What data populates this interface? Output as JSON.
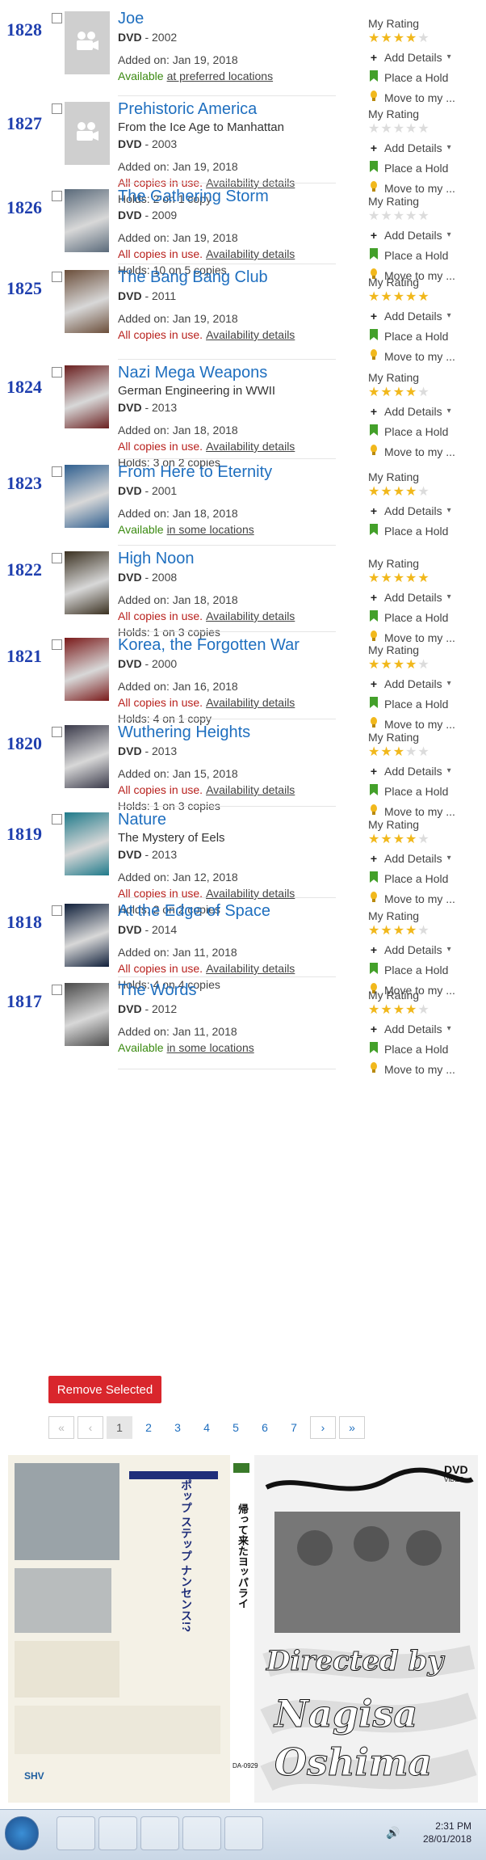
{
  "items": [
    {
      "num": "1828",
      "title": "Joe",
      "subtitle": "",
      "format": "DVD",
      "year": "2002",
      "added": "Added on: Jan 19, 2018",
      "status_text": "Available",
      "status_kind": "available",
      "status_link": "at preferred locations",
      "holds": "",
      "rating": 3.5,
      "actions": [
        "Add Details",
        "Place a Hold",
        "Move to my ..."
      ]
    },
    {
      "num": "1827",
      "title": "Prehistoric America",
      "subtitle": "From the Ice Age to Manhattan",
      "format": "DVD",
      "year": "2003",
      "added": "Added on: Jan 19, 2018",
      "status_text": "All copies in use.",
      "status_kind": "inuse",
      "status_link": "Availability details",
      "holds": "Holds: 2 on 1 copy",
      "rating": 0,
      "actions": [
        "Add Details",
        "Place a Hold",
        "Move to my ..."
      ]
    },
    {
      "num": "1826",
      "title": "The Gathering Storm",
      "subtitle": "",
      "format": "DVD",
      "year": "2009",
      "added": "Added on: Jan 19, 2018",
      "status_text": "All copies in use.",
      "status_kind": "inuse",
      "status_link": "Availability details",
      "holds": "Holds: 10 on 5 copies",
      "rating": 0,
      "actions": [
        "Add Details",
        "Place a Hold",
        "Move to my ..."
      ]
    },
    {
      "num": "1825",
      "title": "The Bang Bang Club",
      "subtitle": "",
      "format": "DVD",
      "year": "2011",
      "added": "Added on: Jan 19, 2018",
      "status_text": "All copies in use.",
      "status_kind": "inuse",
      "status_link": "Availability details",
      "holds": "",
      "rating": 4.5,
      "actions": [
        "Add Details",
        "Place a Hold",
        "Move to my ..."
      ]
    },
    {
      "num": "1824",
      "title": "Nazi Mega Weapons",
      "subtitle": "German Engineering in WWII",
      "format": "DVD",
      "year": "2013",
      "added": "Added on: Jan 18, 2018",
      "status_text": "All copies in use.",
      "status_kind": "inuse",
      "status_link": "Availability details",
      "holds": "Holds: 3 on 2 copies",
      "rating": 4,
      "actions": [
        "Add Details",
        "Place a Hold",
        "Move to my ..."
      ]
    },
    {
      "num": "1823",
      "title": "From Here to Eternity",
      "subtitle": "",
      "format": "DVD",
      "year": "2001",
      "added": "Added on: Jan 18, 2018",
      "status_text": "Available",
      "status_kind": "available",
      "status_link": "in some locations",
      "holds": "",
      "rating": 4,
      "actions": [
        "Add Details",
        "Place a Hold"
      ]
    },
    {
      "num": "1822",
      "title": "High Noon",
      "subtitle": "",
      "format": "DVD",
      "year": "2008",
      "added": "Added on: Jan 18, 2018",
      "status_text": "All copies in use.",
      "status_kind": "inuse",
      "status_link": "Availability details",
      "holds": "Holds: 1 on 3 copies",
      "rating": 4.5,
      "actions": [
        "Add Details",
        "Place a Hold",
        "Move to my ..."
      ]
    },
    {
      "num": "1821",
      "title": "Korea, the Forgotten War",
      "subtitle": "",
      "format": "DVD",
      "year": "2000",
      "added": "Added on: Jan 16, 2018",
      "status_text": "All copies in use.",
      "status_kind": "inuse",
      "status_link": "Availability details",
      "holds": "Holds: 4 on 1 copy",
      "rating": 3.5,
      "actions": [
        "Add Details",
        "Place a Hold",
        "Move to my ..."
      ]
    },
    {
      "num": "1820",
      "title": "Wuthering Heights",
      "subtitle": "",
      "format": "DVD",
      "year": "2013",
      "added": "Added on: Jan 15, 2018",
      "status_text": "All copies in use.",
      "status_kind": "inuse",
      "status_link": "Availability details",
      "holds": "Holds: 1 on 3 copies",
      "rating": 2.5,
      "actions": [
        "Add Details",
        "Place a Hold",
        "Move to my ..."
      ]
    },
    {
      "num": "1819",
      "title": "Nature",
      "subtitle": "The Mystery of Eels",
      "format": "DVD",
      "year": "2013",
      "added": "Added on: Jan 12, 2018",
      "status_text": "All copies in use.",
      "status_kind": "inuse",
      "status_link": "Availability details",
      "holds": "Holds: 2 on 2 copies",
      "rating": 3.5,
      "actions": [
        "Add Details",
        "Place a Hold",
        "Move to my ..."
      ]
    },
    {
      "num": "1818",
      "title": "At the Edge of Space",
      "subtitle": "",
      "format": "DVD",
      "year": "2014",
      "added": "Added on: Jan 11, 2018",
      "status_text": "All copies in use.",
      "status_kind": "inuse",
      "status_link": "Availability details",
      "holds": "Holds: 4 on 4 copies",
      "rating": 4,
      "actions": [
        "Add Details",
        "Place a Hold",
        "Move to my ..."
      ]
    },
    {
      "num": "1817",
      "title": "The Words",
      "subtitle": "",
      "format": "DVD",
      "year": "2012",
      "added": "Added on: Jan 11, 2018",
      "status_text": "Available",
      "status_kind": "available",
      "status_link": "in some locations",
      "holds": "",
      "rating": 4,
      "actions": [
        "Add Details",
        "Place a Hold",
        "Move to my ..."
      ]
    }
  ],
  "my_rating_label": "My Rating",
  "remove_button": "Remove Selected",
  "pagination": {
    "first": "«",
    "prev": "‹",
    "pages": [
      "1",
      "2",
      "3",
      "4",
      "5",
      "6",
      "7"
    ],
    "current": "1",
    "next": "›",
    "last": "»"
  },
  "poster": {
    "directed_by": "Directed by",
    "director": "Nagisa Oshima",
    "dvd": "DVD",
    "video": "VIDEO",
    "jp_tagline": "ポップ ステップ ナンセンス!?",
    "jp_title": "帰って来たヨッパライ",
    "code": "DA-0929",
    "label": "SHV"
  },
  "taskbar": {
    "time": "2:31 PM",
    "date": "28/01/2018"
  },
  "colors": {
    "link": "#1f6fbf",
    "in_use": "#b8211d",
    "available": "#3a8a10",
    "star": "#f1b81c",
    "number": "#1f3fae",
    "remove": "#d9262c"
  }
}
